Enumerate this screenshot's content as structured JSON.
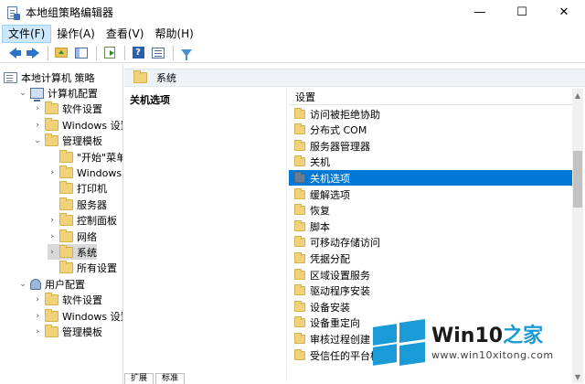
{
  "window": {
    "title": "本地组策略编辑器",
    "minimize": "—",
    "maximize": "☐",
    "close": "✕"
  },
  "menu": [
    {
      "label": "文件(F)",
      "active": true
    },
    {
      "label": "操作(A)",
      "active": false
    },
    {
      "label": "查看(V)",
      "active": false
    },
    {
      "label": "帮助(H)",
      "active": false
    }
  ],
  "toolbar": {
    "icons": [
      "back-arrow-icon",
      "forward-arrow-icon",
      "up-folder-icon",
      "show-hide-tree-icon",
      "export-list-icon",
      "help-icon",
      "properties-icon",
      "filter-icon"
    ],
    "help_glyph": "?"
  },
  "tree": [
    {
      "label": "本地计算机 策略",
      "indent": 0,
      "icon": "policy",
      "twisty": "",
      "selected": false
    },
    {
      "label": "计算机配置",
      "indent": 1,
      "icon": "pc",
      "twisty": "⌄",
      "selected": false
    },
    {
      "label": "软件设置",
      "indent": 2,
      "icon": "folder",
      "twisty": "›",
      "selected": false
    },
    {
      "label": "Windows 设置",
      "indent": 2,
      "icon": "folder",
      "twisty": "›",
      "selected": false
    },
    {
      "label": "管理模板",
      "indent": 2,
      "icon": "folder",
      "twisty": "⌄",
      "selected": false
    },
    {
      "label": "\"开始\"菜单和",
      "indent": 3,
      "icon": "folder",
      "twisty": "",
      "selected": false
    },
    {
      "label": "Windows 组件",
      "indent": 3,
      "icon": "folder",
      "twisty": "›",
      "selected": false
    },
    {
      "label": "打印机",
      "indent": 3,
      "icon": "folder",
      "twisty": "",
      "selected": false
    },
    {
      "label": "服务器",
      "indent": 3,
      "icon": "folder",
      "twisty": "",
      "selected": false
    },
    {
      "label": "控制面板",
      "indent": 3,
      "icon": "folder",
      "twisty": "›",
      "selected": false
    },
    {
      "label": "网络",
      "indent": 3,
      "icon": "folder",
      "twisty": "›",
      "selected": false
    },
    {
      "label": "系统",
      "indent": 3,
      "icon": "folder",
      "twisty": "›",
      "selected": true
    },
    {
      "label": "所有设置",
      "indent": 3,
      "icon": "folder",
      "twisty": "",
      "selected": false
    },
    {
      "label": "用户配置",
      "indent": 1,
      "icon": "user",
      "twisty": "⌄",
      "selected": false
    },
    {
      "label": "软件设置",
      "indent": 2,
      "icon": "folder",
      "twisty": "›",
      "selected": false
    },
    {
      "label": "Windows 设置",
      "indent": 2,
      "icon": "folder",
      "twisty": "›",
      "selected": false
    },
    {
      "label": "管理模板",
      "indent": 2,
      "icon": "folder",
      "twisty": "›",
      "selected": false
    }
  ],
  "right": {
    "header": "系统",
    "section_title": "关机选项",
    "column_header": "设置",
    "items": [
      {
        "label": "访问被拒绝协助",
        "selected": false
      },
      {
        "label": "分布式 COM",
        "selected": false
      },
      {
        "label": "服务器管理器",
        "selected": false
      },
      {
        "label": "关机",
        "selected": false
      },
      {
        "label": "关机选项",
        "selected": true
      },
      {
        "label": "缓解选项",
        "selected": false
      },
      {
        "label": "恢复",
        "selected": false
      },
      {
        "label": "脚本",
        "selected": false
      },
      {
        "label": "可移动存储访问",
        "selected": false
      },
      {
        "label": "凭据分配",
        "selected": false
      },
      {
        "label": "区域设置服务",
        "selected": false
      },
      {
        "label": "驱动程序安装",
        "selected": false
      },
      {
        "label": "设备安装",
        "selected": false
      },
      {
        "label": "设备重定向",
        "selected": false
      },
      {
        "label": "审核过程创建",
        "selected": false
      },
      {
        "label": "受信任的平台模",
        "selected": false
      }
    ]
  },
  "scrollbar": {
    "up": "▲",
    "down": "▼"
  },
  "bottom_tabs": [
    "扩展",
    "标准"
  ],
  "watermark": {
    "brand_prefix": "Win10",
    "brand_suffix": "之家",
    "url": "www.win10xitong.com",
    "logo_color": "#1a9ad6"
  },
  "colors": {
    "selection": "#0078d7",
    "menu_highlight": "#cce8ff",
    "folder": "#f1d27b"
  }
}
